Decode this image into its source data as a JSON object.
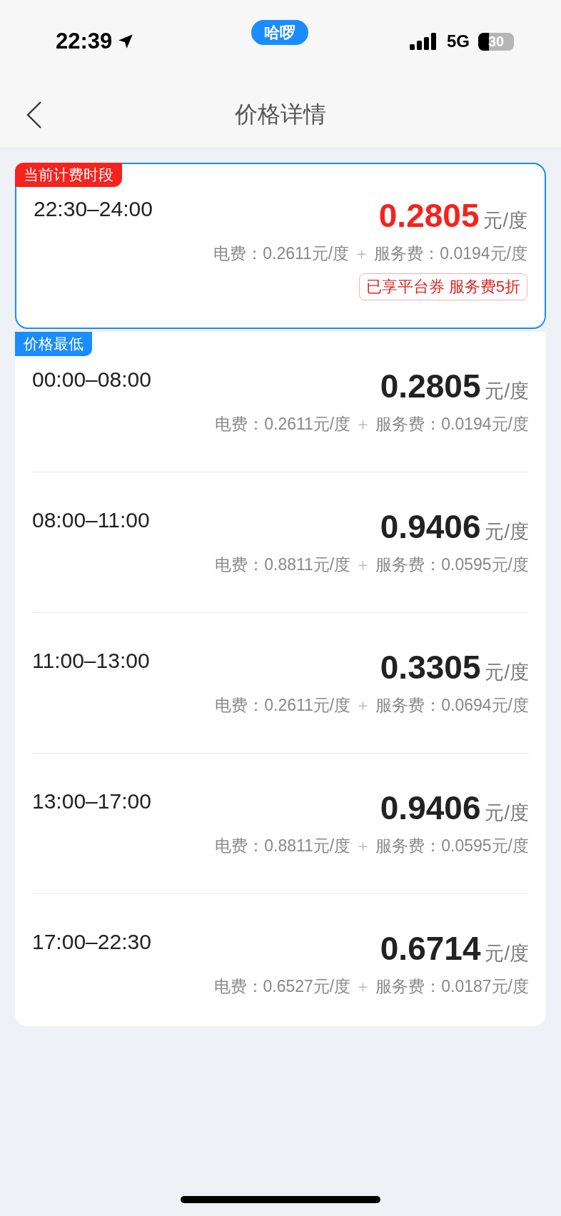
{
  "status_bar": {
    "time": "22:39",
    "app_pill": "哈啰",
    "network": "5G",
    "battery": "30"
  },
  "nav": {
    "title": "价格详情"
  },
  "periods": [
    {
      "time": "22:30–24:00",
      "price": "0.2805",
      "unit": "元/度",
      "electricity": "电费：0.2611元/度",
      "plus": "＋",
      "service": "服务费：0.0194元/度",
      "current": true,
      "badge": {
        "kind": "current",
        "text": "当前计费时段"
      },
      "coupon": "已享平台券 服务费5折"
    },
    {
      "time": "00:00–08:00",
      "price": "0.2805",
      "unit": "元/度",
      "electricity": "电费：0.2611元/度",
      "plus": "＋",
      "service": "服务费：0.0194元/度",
      "current": false,
      "badge": {
        "kind": "lowest",
        "text": "价格最低"
      }
    },
    {
      "time": "08:00–11:00",
      "price": "0.9406",
      "unit": "元/度",
      "electricity": "电费：0.8811元/度",
      "plus": "＋",
      "service": "服务费：0.0595元/度",
      "current": false
    },
    {
      "time": "11:00–13:00",
      "price": "0.3305",
      "unit": "元/度",
      "electricity": "电费：0.2611元/度",
      "plus": "＋",
      "service": "服务费：0.0694元/度",
      "current": false
    },
    {
      "time": "13:00–17:00",
      "price": "0.9406",
      "unit": "元/度",
      "electricity": "电费：0.8811元/度",
      "plus": "＋",
      "service": "服务费：0.0595元/度",
      "current": false
    },
    {
      "time": "17:00–22:30",
      "price": "0.6714",
      "unit": "元/度",
      "electricity": "电费：0.6527元/度",
      "plus": "＋",
      "service": "服务费：0.0187元/度",
      "current": false
    }
  ]
}
